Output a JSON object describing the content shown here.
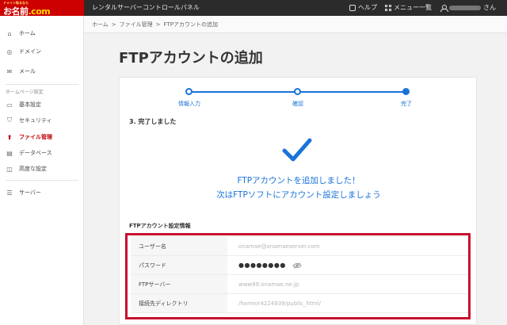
{
  "header": {
    "tagline": "ドメイン取るなら",
    "brand_main": "お名前",
    "brand_dot": ".com",
    "app_title": "レンタルサーバーコントロールパネル",
    "help_label": "ヘルプ",
    "menu_label": "メニュー一覧",
    "user_suffix": "さん"
  },
  "sidebar": {
    "items_top": [
      {
        "label": "ホーム",
        "icon": "home-icon"
      },
      {
        "label": "ドメイン",
        "icon": "globe-icon"
      },
      {
        "label": "メール",
        "icon": "mail-icon"
      }
    ],
    "section_label": "ホームページ設定",
    "items_site": [
      {
        "label": "基本設定",
        "icon": "monitor-icon"
      },
      {
        "label": "セキュリティ",
        "icon": "shield-icon"
      },
      {
        "label": "ファイル管理",
        "icon": "upload-icon",
        "active": true
      },
      {
        "label": "データベース",
        "icon": "database-icon"
      },
      {
        "label": "高度な設定",
        "icon": "settings-icon"
      }
    ],
    "items_bottom": [
      {
        "label": "サーバー",
        "icon": "server-icon"
      }
    ]
  },
  "breadcrumb": {
    "items": [
      "ホーム",
      "ファイル管理",
      "FTPアカウントの追加"
    ],
    "separator": ">"
  },
  "main": {
    "title": "FTPアカウントの追加",
    "steps": [
      "情報入力",
      "確認",
      "完了"
    ],
    "done_heading": "3. 完了しました",
    "message_line1": "FTPアカウントを追加しました！",
    "message_line2": "次はFTPソフトにアカウント設定しましょう",
    "info_heading": "FTPアカウント設定情報",
    "info_rows": [
      {
        "key": "ユーザー名",
        "value": "onamae@onamaeserver.com"
      },
      {
        "key": "パスワード",
        "value": "●●●●●●●●"
      },
      {
        "key": "FTPサーバー",
        "value": "www99.onamae.ne.jp"
      },
      {
        "key": "接続先ディレクトリ",
        "value": "/home/r4224939/public_html/"
      }
    ]
  },
  "colors": {
    "accent": "#1a73d9",
    "brand": "#cc0000",
    "highlight": "#c8102e",
    "topbar": "#2b2b2b"
  }
}
